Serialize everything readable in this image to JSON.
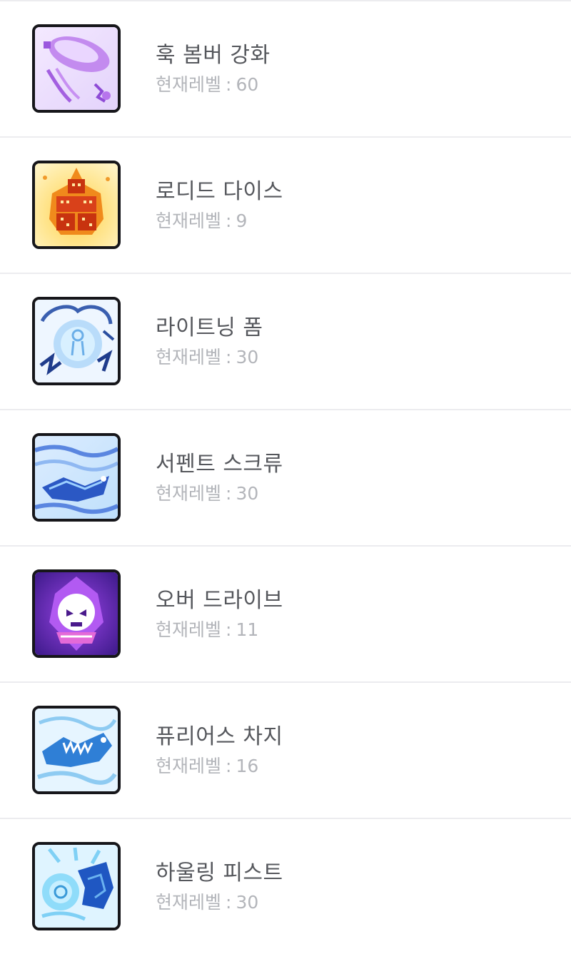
{
  "skill_list": {
    "level_prefix": "현재레벨",
    "level_separator": ":",
    "items": [
      {
        "name": "훅 봄버 강화",
        "level": "60",
        "icon": "hook-bomber-icon"
      },
      {
        "name": "로디드 다이스",
        "level": "9",
        "icon": "loaded-dice-icon"
      },
      {
        "name": "라이트닝 폼",
        "level": "30",
        "icon": "lightning-form-icon"
      },
      {
        "name": "서펜트 스크류",
        "level": "30",
        "icon": "serpent-screw-icon"
      },
      {
        "name": "오버 드라이브",
        "level": "11",
        "icon": "overdrive-icon"
      },
      {
        "name": "퓨리어스 차지",
        "level": "16",
        "icon": "furious-charge-icon"
      },
      {
        "name": "하울링 피스트",
        "level": "30",
        "icon": "howling-fist-icon"
      }
    ]
  }
}
